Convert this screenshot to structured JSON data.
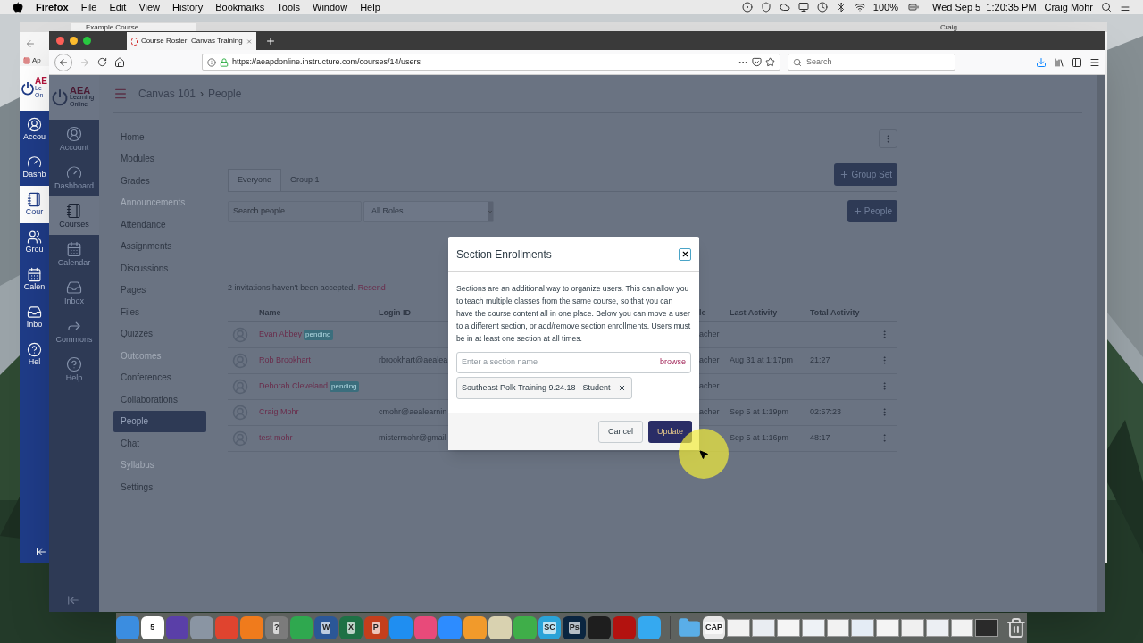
{
  "menu_bar": {
    "app": "Firefox",
    "menus": [
      "File",
      "Edit",
      "View",
      "History",
      "Bookmarks",
      "Tools",
      "Window",
      "Help"
    ],
    "battery": "100%",
    "clock": "Wed Sep 5  1:20:35 PM",
    "user": "Craig Mohr"
  },
  "back_window": {
    "tab_title": "Example Course",
    "user": "Craig",
    "bookmark": "Ap",
    "logo": "AE",
    "logo_lines": [
      "Le",
      "On"
    ],
    "nav": [
      {
        "label": "Accou",
        "selected": false
      },
      {
        "label": "Dashb",
        "selected": false
      },
      {
        "label": "Cour",
        "selected": true
      },
      {
        "label": "Grou",
        "selected": false
      },
      {
        "label": "Calen",
        "selected": false
      },
      {
        "label": "Inbo",
        "selected": false
      },
      {
        "label": "Hel",
        "selected": false
      }
    ]
  },
  "browser": {
    "tab_title": "Course Roster: Canvas Training",
    "url": "https://aeapdonline.instructure.com/courses/14/users",
    "search_placeholder": "Search"
  },
  "global_nav": {
    "logo": "AEA",
    "logo_lines": [
      "Learning",
      "Online"
    ],
    "items": [
      {
        "label": "Account",
        "selected": false
      },
      {
        "label": "Dashboard",
        "selected": false
      },
      {
        "label": "Courses",
        "selected": true
      },
      {
        "label": "Calendar",
        "selected": false
      },
      {
        "label": "Inbox",
        "selected": false
      },
      {
        "label": "Commons",
        "selected": false
      },
      {
        "label": "Help",
        "selected": false
      }
    ]
  },
  "breadcrumb": [
    "Canvas 101",
    "People"
  ],
  "breadcrumb_separator": "›",
  "course_nav": [
    {
      "label": "Home",
      "disabled": false,
      "selected": false
    },
    {
      "label": "Modules",
      "disabled": false,
      "selected": false
    },
    {
      "label": "Grades",
      "disabled": false,
      "selected": false
    },
    {
      "label": "Announcements",
      "disabled": true,
      "selected": false
    },
    {
      "label": "Attendance",
      "disabled": false,
      "selected": false
    },
    {
      "label": "Assignments",
      "disabled": false,
      "selected": false
    },
    {
      "label": "Discussions",
      "disabled": false,
      "selected": false
    },
    {
      "label": "Pages",
      "disabled": false,
      "selected": false
    },
    {
      "label": "Files",
      "disabled": false,
      "selected": false
    },
    {
      "label": "Quizzes",
      "disabled": false,
      "selected": false
    },
    {
      "label": "Outcomes",
      "disabled": true,
      "selected": false
    },
    {
      "label": "Conferences",
      "disabled": false,
      "selected": false
    },
    {
      "label": "Collaborations",
      "disabled": false,
      "selected": false
    },
    {
      "label": "People",
      "disabled": false,
      "selected": true
    },
    {
      "label": "Chat",
      "disabled": false,
      "selected": false
    },
    {
      "label": "Syllabus",
      "disabled": true,
      "selected": false
    },
    {
      "label": "Settings",
      "disabled": false,
      "selected": false
    }
  ],
  "tabs": [
    {
      "label": "Everyone",
      "selected": true
    },
    {
      "label": "Group 1",
      "selected": false
    }
  ],
  "group_set_button": "Group Set",
  "people_button": "People",
  "search": {
    "placeholder": "Search people"
  },
  "role_filter": {
    "value": "All Roles"
  },
  "invitations": {
    "text": "2 invitations haven't been accepted.",
    "link": "Resend"
  },
  "table": {
    "columns": [
      "Name",
      "Login ID",
      "le",
      "Last Activity",
      "Total Activity"
    ],
    "rows": [
      {
        "name": "Evan Abbey",
        "badge": "pending",
        "role": "acher"
      },
      {
        "name": "Rob Brookhart",
        "login_id": "rbrookhart@aealea",
        "role": "acher",
        "last_activity": "Aug 31 at 1:17pm",
        "total_activity": "21:27"
      },
      {
        "name": "Deborah Cleveland",
        "badge": "pending",
        "role": "acher"
      },
      {
        "name": "Craig Mohr",
        "login_id": "cmohr@aealearnin",
        "role": "acher",
        "last_activity": "Sep 5 at 1:19pm",
        "total_activity": "02:57:23"
      },
      {
        "name": "test mohr",
        "login_id": "mistermohr@gmail",
        "last_activity": "Sep 5 at 1:16pm",
        "total_activity": "48:17"
      }
    ]
  },
  "dialog": {
    "title": "Section Enrollments",
    "body": "Sections are an additional way to organize users. This can allow you to teach multiple classes from the same course, so that you can have the course content all in one place. Below you can move a user to a different section, or add/remove section enrollments. Users must be in at least one section at all times.",
    "input_placeholder": "Enter a section name",
    "browse": "browse",
    "sections": [
      "Southeast Polk Training 9.24.18 - Student"
    ],
    "cancel": "Cancel",
    "update": "Update"
  },
  "dock": [
    {
      "kind": "app",
      "color": "#3b8de0"
    },
    {
      "kind": "app",
      "color": "#ffffff",
      "label": "5"
    },
    {
      "kind": "app",
      "color": "#5a3fa8"
    },
    {
      "kind": "app",
      "color": "#8a95a3"
    },
    {
      "kind": "app",
      "color": "#e0442f"
    },
    {
      "kind": "app",
      "color": "#f07b1c"
    },
    {
      "kind": "app",
      "color": "#7b7b7b",
      "label": "?"
    },
    {
      "kind": "app",
      "color": "#2fa84f"
    },
    {
      "kind": "app",
      "color": "#2b5797",
      "label": "W"
    },
    {
      "kind": "app",
      "color": "#1e7145",
      "label": "X"
    },
    {
      "kind": "app",
      "color": "#c43e1c",
      "label": "P"
    },
    {
      "kind": "app",
      "color": "#1f8ef1"
    },
    {
      "kind": "app",
      "color": "#e84a7a"
    },
    {
      "kind": "app",
      "color": "#2d8cff"
    },
    {
      "kind": "app",
      "color": "#f19a2b"
    },
    {
      "kind": "app",
      "color": "#d9d2b0"
    },
    {
      "kind": "app",
      "color": "#3fae49"
    },
    {
      "kind": "app",
      "color": "#2aa3d8",
      "label": "SC"
    },
    {
      "kind": "app",
      "color": "#0a2540",
      "label": "Ps"
    },
    {
      "kind": "app",
      "color": "#1e1e1e"
    },
    {
      "kind": "app",
      "color": "#b3120f"
    },
    {
      "kind": "app",
      "color": "#35a9f0"
    },
    {
      "kind": "folder",
      "color": "#5aaee8"
    },
    {
      "kind": "app",
      "color": "#e8e8e8",
      "label": "CAP"
    },
    {
      "kind": "window",
      "color": "#f2f2f2"
    },
    {
      "kind": "window",
      "color": "#e9edf2"
    },
    {
      "kind": "window",
      "color": "#f5f5f5"
    },
    {
      "kind": "window",
      "color": "#eef2f6"
    },
    {
      "kind": "window",
      "color": "#f2f2f2"
    },
    {
      "kind": "window",
      "color": "#e4ecf5"
    },
    {
      "kind": "window",
      "color": "#f4f4f4"
    },
    {
      "kind": "window",
      "color": "#f0f0f0"
    },
    {
      "kind": "window",
      "color": "#eceff3"
    },
    {
      "kind": "window",
      "color": "#f2f2f2"
    },
    {
      "kind": "window",
      "color": "#2a2a2a"
    },
    {
      "kind": "trash",
      "color": "#d8d8d8"
    }
  ]
}
